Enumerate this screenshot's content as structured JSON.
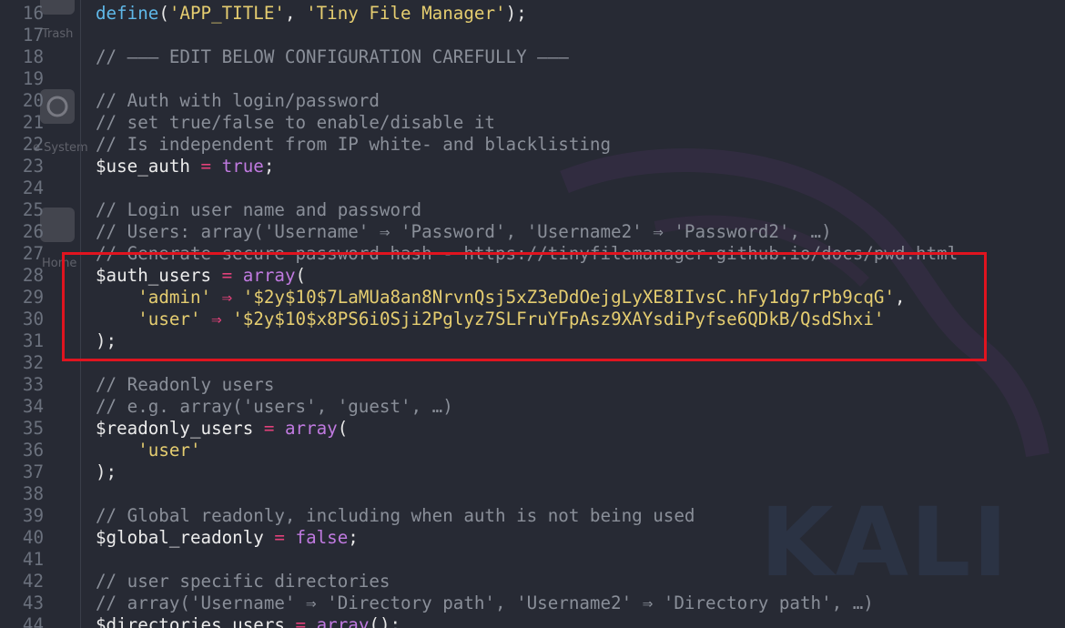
{
  "desktop": {
    "icons": [
      {
        "label": "Trash"
      },
      {
        "label": "e System"
      },
      {
        "label": "Home"
      }
    ],
    "watermark": "KALI"
  },
  "editor": {
    "lines": [
      {
        "num": "16",
        "tokens": [
          {
            "t": "fn",
            "v": "define"
          },
          {
            "t": "punc",
            "v": "("
          },
          {
            "t": "str",
            "v": "'APP_TITLE'"
          },
          {
            "t": "punc",
            "v": ", "
          },
          {
            "t": "str",
            "v": "'Tiny File Manager'"
          },
          {
            "t": "punc",
            "v": ");"
          }
        ]
      },
      {
        "num": "17",
        "tokens": []
      },
      {
        "num": "18",
        "tokens": [
          {
            "t": "cm",
            "v": "// ——— EDIT BELOW CONFIGURATION CAREFULLY ———"
          }
        ]
      },
      {
        "num": "19",
        "tokens": []
      },
      {
        "num": "20",
        "tokens": [
          {
            "t": "cm",
            "v": "// Auth with login/password"
          }
        ]
      },
      {
        "num": "21",
        "tokens": [
          {
            "t": "cm",
            "v": "// set true/false to enable/disable it"
          }
        ]
      },
      {
        "num": "22",
        "tokens": [
          {
            "t": "cm",
            "v": "// Is independent from IP white- and blacklisting"
          }
        ]
      },
      {
        "num": "23",
        "tokens": [
          {
            "t": "var",
            "v": "$use_auth "
          },
          {
            "t": "op",
            "v": "="
          },
          {
            "t": "punc",
            "v": " "
          },
          {
            "t": "kw",
            "v": "true"
          },
          {
            "t": "punc",
            "v": ";"
          }
        ]
      },
      {
        "num": "24",
        "tokens": []
      },
      {
        "num": "25",
        "tokens": [
          {
            "t": "cm",
            "v": "// Login user name and password"
          }
        ]
      },
      {
        "num": "26",
        "tokens": [
          {
            "t": "cm",
            "v": "// Users: array('Username' ⇒ 'Password', 'Username2' ⇒ 'Password2', …)"
          }
        ]
      },
      {
        "num": "27",
        "tokens": [
          {
            "t": "cm",
            "v": "// Generate secure password hash - https://tinyfilemanager.github.io/docs/pwd.html"
          }
        ]
      },
      {
        "num": "28",
        "tokens": [
          {
            "t": "var",
            "v": "$auth_users "
          },
          {
            "t": "op",
            "v": "="
          },
          {
            "t": "punc",
            "v": " "
          },
          {
            "t": "kw",
            "v": "array"
          },
          {
            "t": "punc",
            "v": "("
          }
        ]
      },
      {
        "num": "29",
        "tokens": [
          {
            "t": "punc",
            "v": "    "
          },
          {
            "t": "str",
            "v": "'admin'"
          },
          {
            "t": "punc",
            "v": " "
          },
          {
            "t": "op",
            "v": "⇒"
          },
          {
            "t": "punc",
            "v": " "
          },
          {
            "t": "str",
            "v": "'$2y$10$7LaMUa8an8NrvnQsj5xZ3eDdOejgLyXE8IIvsC.hFy1dg7rPb9cqG'"
          },
          {
            "t": "punc",
            "v": ","
          }
        ]
      },
      {
        "num": "30",
        "tokens": [
          {
            "t": "punc",
            "v": "    "
          },
          {
            "t": "str",
            "v": "'user'"
          },
          {
            "t": "punc",
            "v": " "
          },
          {
            "t": "op",
            "v": "⇒"
          },
          {
            "t": "punc",
            "v": " "
          },
          {
            "t": "str",
            "v": "'$2y$10$x8PS6i0Sji2Pglyz7SLFruYFpAsz9XAYsdiPyfse6QDkB/QsdShxi'"
          }
        ]
      },
      {
        "num": "31",
        "tokens": [
          {
            "t": "punc",
            "v": ");"
          }
        ]
      },
      {
        "num": "32",
        "tokens": []
      },
      {
        "num": "33",
        "tokens": [
          {
            "t": "cm",
            "v": "// Readonly users"
          }
        ]
      },
      {
        "num": "34",
        "tokens": [
          {
            "t": "cm",
            "v": "// e.g. array('users', 'guest', …)"
          }
        ]
      },
      {
        "num": "35",
        "tokens": [
          {
            "t": "var",
            "v": "$readonly_users "
          },
          {
            "t": "op",
            "v": "="
          },
          {
            "t": "punc",
            "v": " "
          },
          {
            "t": "kw",
            "v": "array"
          },
          {
            "t": "punc",
            "v": "("
          }
        ]
      },
      {
        "num": "36",
        "tokens": [
          {
            "t": "punc",
            "v": "    "
          },
          {
            "t": "str",
            "v": "'user'"
          }
        ]
      },
      {
        "num": "37",
        "tokens": [
          {
            "t": "punc",
            "v": ");"
          }
        ]
      },
      {
        "num": "38",
        "tokens": []
      },
      {
        "num": "39",
        "tokens": [
          {
            "t": "cm",
            "v": "// Global readonly, including when auth is not being used"
          }
        ]
      },
      {
        "num": "40",
        "tokens": [
          {
            "t": "var",
            "v": "$global_readonly "
          },
          {
            "t": "op",
            "v": "="
          },
          {
            "t": "punc",
            "v": " "
          },
          {
            "t": "kw",
            "v": "false"
          },
          {
            "t": "punc",
            "v": ";"
          }
        ]
      },
      {
        "num": "41",
        "tokens": []
      },
      {
        "num": "42",
        "tokens": [
          {
            "t": "cm",
            "v": "// user specific directories"
          }
        ]
      },
      {
        "num": "43",
        "tokens": [
          {
            "t": "cm",
            "v": "// array('Username' ⇒ 'Directory path', 'Username2' ⇒ 'Directory path', …)"
          }
        ]
      },
      {
        "num": "44",
        "tokens": [
          {
            "t": "var",
            "v": "$directories_users "
          },
          {
            "t": "op",
            "v": "="
          },
          {
            "t": "punc",
            "v": " "
          },
          {
            "t": "kw",
            "v": "array"
          },
          {
            "t": "punc",
            "v": "();"
          }
        ]
      }
    ]
  },
  "colors": {
    "background": "#272a34",
    "function": "#5fb8e8",
    "string": "#e5cd70",
    "keyword": "#c07ae0",
    "comment": "#8a8f99",
    "operator": "#e2417a",
    "highlight_box": "#e0141f"
  }
}
